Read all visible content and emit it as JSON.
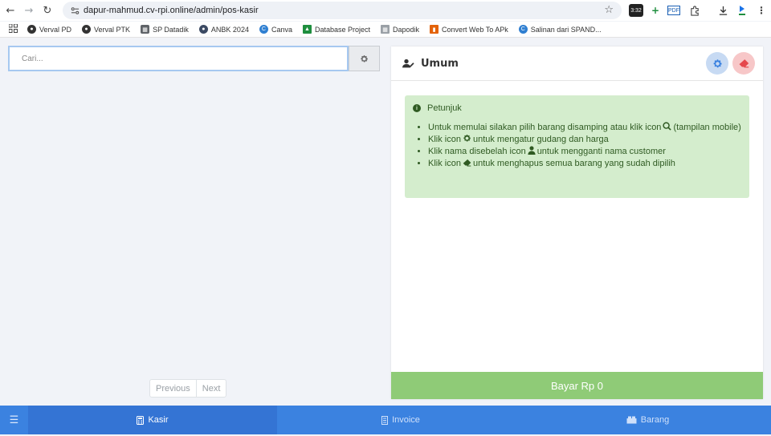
{
  "browser": {
    "url": "dapur-mahmud.cv-rpi.online/admin/pos-kasir",
    "timer_badge": "3:32",
    "bookmarks": [
      {
        "label": "Verval PD",
        "color": "#333333"
      },
      {
        "label": "Verval PTK",
        "color": "#333333"
      },
      {
        "label": "SP Datadik",
        "color": "#5f6368"
      },
      {
        "label": "ANBK 2024",
        "color": "#3c4a63"
      },
      {
        "label": "Canva",
        "color": "#2f7fd1"
      },
      {
        "label": "Database Project",
        "color": "#1e8e3e"
      },
      {
        "label": "Dapodik",
        "color": "#7b7b7b"
      },
      {
        "label": "Convert Web To APk",
        "color": "#e36209"
      },
      {
        "label": "Salinan dari SPAND...",
        "color": "#2f7fd1"
      }
    ]
  },
  "search": {
    "placeholder": "Cari..."
  },
  "pagination": {
    "previous": "Previous",
    "next": "Next"
  },
  "customer": {
    "name": "Umum"
  },
  "help": {
    "title": "Petunjuk",
    "items": [
      {
        "before": "Untuk memulai silakan pilih barang disamping atau klik icon",
        "after": "(tampilan mobile)"
      },
      {
        "before": "Klik icon",
        "after": "untuk mengatur gudang dan harga"
      },
      {
        "before": "Klik nama disebelah icon",
        "after": "untuk mengganti nama customer"
      },
      {
        "before": "Klik icon",
        "after": "untuk menghapus semua barang yang sudah dipilih"
      }
    ]
  },
  "pay_button": "Bayar Rp 0",
  "bottom_nav": {
    "tabs": [
      {
        "label": "Kasir",
        "active": true
      },
      {
        "label": "Invoice",
        "active": false
      },
      {
        "label": "Barang",
        "active": false
      }
    ]
  },
  "colors": {
    "primary": "#3b82e0",
    "success": "#8fcb77",
    "alert_bg": "#d4edcd"
  }
}
